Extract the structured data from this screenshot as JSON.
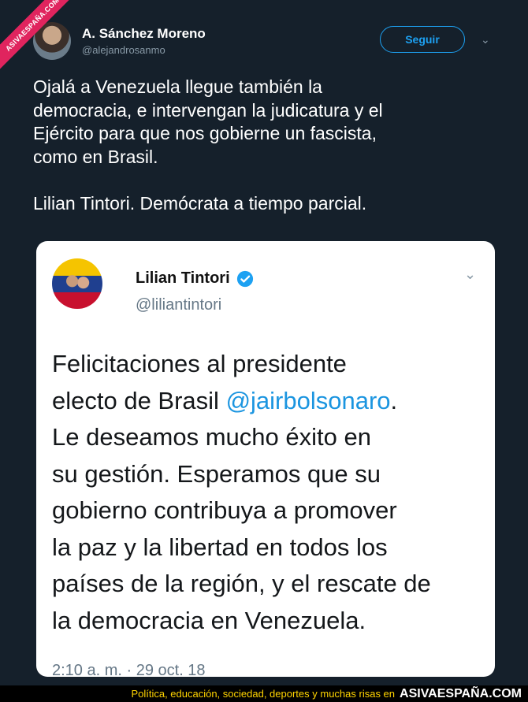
{
  "watermark": {
    "ribbon": "ASIVAESPAÑA.COM"
  },
  "tweet": {
    "author_name": "A. Sánchez Moreno",
    "author_handle": "@alejandrosanmo",
    "follow_label": "Seguir",
    "caret_icon": "chevron-down-icon",
    "text": "Ojalá a Venezuela llegue también la\ndemocracia, e intervengan la judicatura y el\nEjército para que nos gobierne un fascista,\ncomo en Brasil.\n\nLilian Tintori. Demócrata a tiempo parcial."
  },
  "quoted": {
    "name": "Lilian Tintori",
    "handle": "@liliantintori",
    "verified_icon": "verified-badge-icon",
    "lines": [
      "Felicitaciones al presidente",
      "electo de Brasil ",
      "Le deseamos mucho éxito en",
      "su gestión. Esperamos que su",
      "gobierno contribuya a promover",
      "la paz y la libertad en todos los",
      "países de la región, y el rescate de",
      "la democracia en Venezuela."
    ],
    "mention": "@jairbolsonaro",
    "mention_suffix": ".",
    "timestamp": "2:10 a. m. · 29 oct. 18"
  },
  "footer": {
    "tagline": "Política, educación, sociedad, deportes y muchas risas en",
    "brand": "ASIVAESPAÑA.COM"
  },
  "colors": {
    "background": "#15202b",
    "accent": "#1da1f2",
    "footer_text": "#ffd400"
  }
}
